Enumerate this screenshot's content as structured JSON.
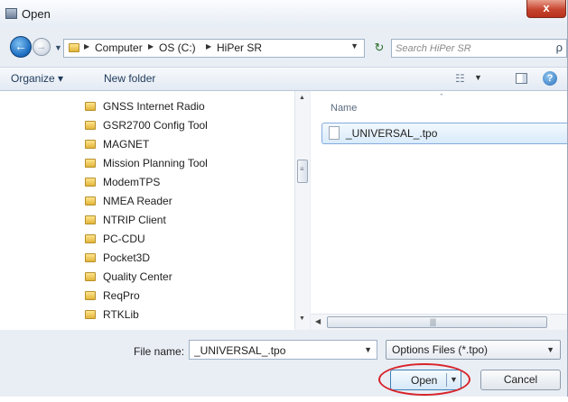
{
  "window": {
    "title": "Open",
    "close_glyph": "x"
  },
  "nav": {
    "back_glyph": "←",
    "forward_glyph": "→",
    "breadcrumbs": [
      "Computer",
      "OS (C:)",
      "HiPer SR"
    ],
    "search_placeholder": "Search HiPer SR",
    "refresh_glyph": "↻",
    "search_icon_glyph": "ρ"
  },
  "toolbar": {
    "organize_label": "Organize ▾",
    "new_folder_label": "New folder",
    "help_glyph": "?"
  },
  "folders": [
    "GNSS Internet Radio",
    "GSR2700 Config Tool",
    "MAGNET",
    "Mission Planning Tool",
    "ModemTPS",
    "NMEA Reader",
    "NTRIP Client",
    "PC-CDU",
    "Pocket3D",
    "Quality Center",
    "ReqPro",
    "RTKLib"
  ],
  "file_list": {
    "column_header": "Name",
    "files": [
      "_UNIVERSAL_.tpo"
    ]
  },
  "footer": {
    "file_name_label": "File name:",
    "file_name_value": "_UNIVERSAL_.tpo",
    "file_type_value": "Options Files (*.tpo)",
    "open_label": "Open",
    "cancel_label": "Cancel"
  },
  "colors": {
    "accent": "#3c7fb1",
    "highlight_ring": "#d8232a",
    "close_button": "#c7452f"
  }
}
